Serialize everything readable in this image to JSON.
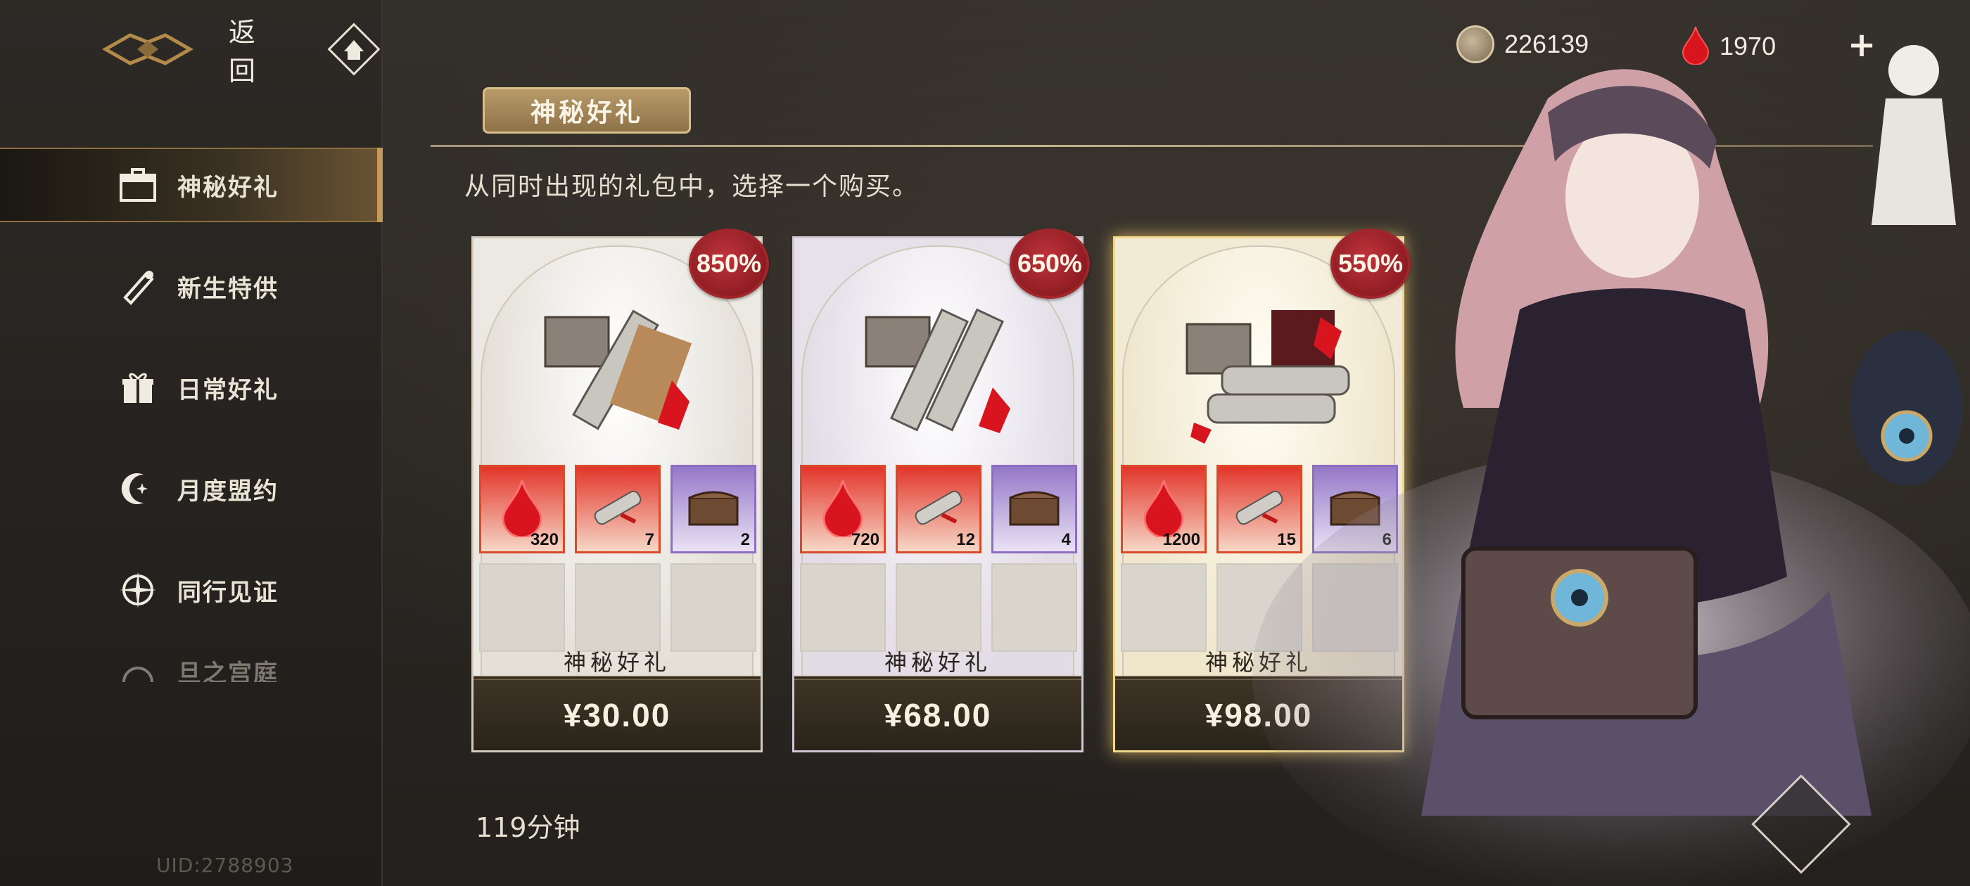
{
  "header": {
    "back_label": "返回"
  },
  "currencies": {
    "coins": "226139",
    "gems": "1970",
    "add_symbol": "+"
  },
  "sidebar": {
    "items": [
      {
        "label": "神秘好礼",
        "icon": "gift-box-icon",
        "active": true
      },
      {
        "label": "新生特供",
        "icon": "scroll-icon",
        "active": false
      },
      {
        "label": "日常好礼",
        "icon": "gift-icon",
        "active": false
      },
      {
        "label": "月度盟约",
        "icon": "moon-star-icon",
        "active": false
      },
      {
        "label": "同行见证",
        "icon": "compass-icon",
        "active": false
      },
      {
        "label": "旦之宫庭",
        "icon": "palace-icon",
        "active": false
      }
    ],
    "uid": "UID:2788903"
  },
  "main": {
    "title": "神秘好礼",
    "subtitle": "从同时出现的礼包中，选择一个购买。",
    "timer": "119分钟",
    "packs": [
      {
        "bonus": "850%",
        "name": "神秘好礼",
        "price": "¥30.00",
        "items": [
          {
            "icon": "red-gem-icon",
            "count": "320"
          },
          {
            "icon": "scroll-item-icon",
            "count": "7"
          },
          {
            "icon": "chest-icon",
            "count": "2"
          }
        ]
      },
      {
        "bonus": "650%",
        "name": "神秘好礼",
        "price": "¥68.00",
        "items": [
          {
            "icon": "red-gem-icon",
            "count": "720"
          },
          {
            "icon": "scroll-item-icon",
            "count": "12"
          },
          {
            "icon": "chest-icon",
            "count": "4"
          }
        ]
      },
      {
        "bonus": "550%",
        "name": "神秘好礼",
        "price": "¥98.00",
        "items": [
          {
            "icon": "red-gem-icon",
            "count": "1200"
          },
          {
            "icon": "scroll-item-icon",
            "count": "15"
          },
          {
            "icon": "chest-icon",
            "count": "6"
          }
        ]
      }
    ]
  },
  "colors": {
    "accent_gold": "#c49a5a",
    "seal_red": "#a0262c",
    "item_red": "#d94a2a",
    "item_purple": "#8d6dc2"
  }
}
